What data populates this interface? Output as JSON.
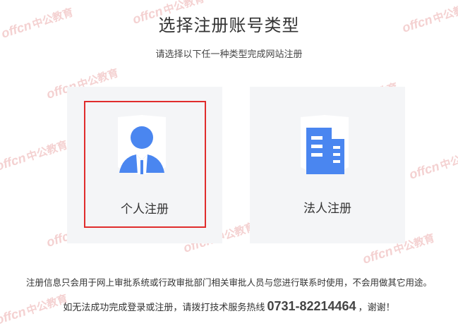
{
  "header": {
    "title": "选择注册账号类型",
    "subtitle": "请选择以下任一种类型完成网站注册"
  },
  "cards": {
    "personal": {
      "label": "个人注册",
      "icon": "person-shield-icon",
      "selected": true
    },
    "corporate": {
      "label": "法人注册",
      "icon": "building-shield-icon",
      "selected": false
    }
  },
  "footer": {
    "notice": "注册信息只会用于网上审批系统或行政审批部门相关审批人员与您进行联系时使用，不会用做其它用途。",
    "hotline_prefix": "如无法成功完成登录或注册，请拨打技术服务热线",
    "hotline_number": "0731-82214464",
    "hotline_suffix": "，谢谢！"
  },
  "watermark": {
    "latin": "offcn",
    "chinese": "中公教育"
  },
  "colors": {
    "icon_blue": "#4a86f0",
    "card_bg": "#f4f5f7",
    "selection_border": "#e02c2c",
    "watermark": "#f1c2c2"
  }
}
